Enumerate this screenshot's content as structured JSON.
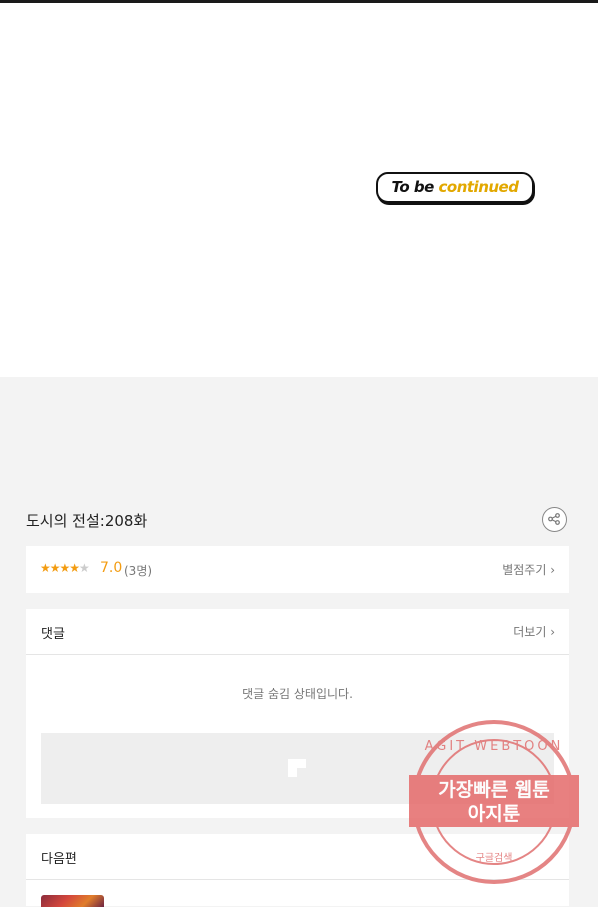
{
  "comic": {
    "banner_text_a": "To be ",
    "banner_text_b": "continued"
  },
  "episode": {
    "title": "도시의 전설:208화"
  },
  "rating": {
    "stars": "★★★",
    "half_star": "★",
    "empty_star": "★",
    "score": "7.0",
    "count": "(3명)",
    "rate_label": "별점주기 ›",
    "value": 7.0,
    "max": 10
  },
  "comments": {
    "title": "댓글",
    "more_label": "더보기 ›",
    "hidden_message": "댓글 숨김 상태입니다."
  },
  "next": {
    "title": "다음편"
  },
  "watermark": {
    "line1": "가장빠른 웹툰",
    "line2": "아지툰",
    "ring_text": "AGIT WEBTOON",
    "bottom_text": "구글검색"
  },
  "colors": {
    "star": "#f39c12",
    "stamp": "#e05a5a"
  }
}
